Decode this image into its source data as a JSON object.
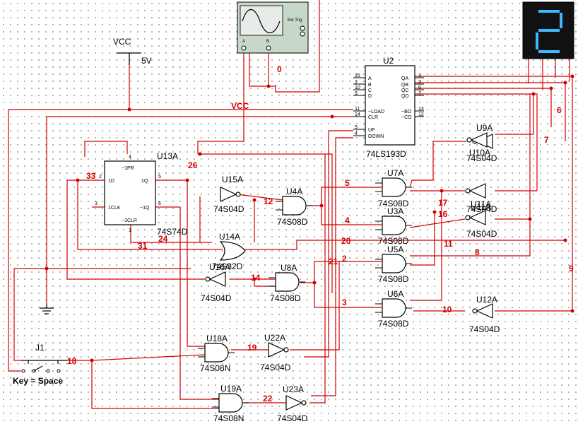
{
  "power": {
    "vcc_top": "VCC",
    "vcc_volts": "5V",
    "vcc_mid": "VCC"
  },
  "scope": {
    "channel_a": "A",
    "channel_b": "B",
    "ext_trig": "Ext Trig"
  },
  "display": {
    "digit": "2",
    "color": "#3db8ff"
  },
  "switch": {
    "ref": "J1",
    "key_label": "Key = Space"
  },
  "counter": {
    "ref": "U2",
    "part": "74LS193D",
    "left_pins": [
      {
        "num": "15",
        "name": "A"
      },
      {
        "num": "1",
        "name": "B"
      },
      {
        "num": "10",
        "name": "C"
      },
      {
        "num": "9",
        "name": "D"
      },
      {
        "num": "11",
        "name": "~LOAD"
      },
      {
        "num": "14",
        "name": "CLR"
      },
      {
        "num": "5",
        "name": "UP"
      },
      {
        "num": "4",
        "name": "DOWN"
      }
    ],
    "right_pins": [
      {
        "num": "3",
        "name": "QA"
      },
      {
        "num": "2",
        "name": "QB"
      },
      {
        "num": "6",
        "name": "QC"
      },
      {
        "num": "7",
        "name": "QD"
      },
      {
        "num": "13",
        "name": "~BO"
      },
      {
        "num": "12",
        "name": "~CO"
      }
    ]
  },
  "flipflop": {
    "ref": "U13A",
    "part": "74S74D",
    "pins": {
      "pr": "~1PR",
      "d": "1D",
      "q": "1Q",
      "clk": "1CLK",
      "qn": "~1Q",
      "clr": "~1CLR",
      "pr_num": "4",
      "d_num": "2",
      "q_num": "5",
      "clk_num": "3",
      "qn_num": "6",
      "clr_num": "1"
    }
  },
  "gates": [
    {
      "ref": "U7A",
      "part": "74S08D"
    },
    {
      "ref": "U3A",
      "part": "74S08D"
    },
    {
      "ref": "U4A",
      "part": "74S08D"
    },
    {
      "ref": "U5A",
      "part": "74S08D"
    },
    {
      "ref": "U8A",
      "part": "74S08D"
    },
    {
      "ref": "U6A",
      "part": "74S08D"
    },
    {
      "ref": "U18A",
      "part": "74S08N"
    },
    {
      "ref": "U19A",
      "part": "74S08N"
    },
    {
      "ref": "U14A",
      "part": "74S32D"
    }
  ],
  "inverters": [
    {
      "ref": "U9A",
      "part": ""
    },
    {
      "ref": "U10A",
      "part": "74S04D"
    },
    {
      "ref": "U11A",
      "part": "74S04D"
    },
    {
      "ref": "U11A",
      "part": "74S04D"
    },
    {
      "ref": "U15A",
      "part": "74S04D"
    },
    {
      "ref": "U16A",
      "part": "74S04D"
    },
    {
      "ref": "U12A",
      "part": "74S04D"
    },
    {
      "ref": "U22A",
      "part": "74S04D"
    },
    {
      "ref": "U23A",
      "part": "74S04D"
    }
  ],
  "nets": [
    "0",
    "6",
    "7",
    "5",
    "4",
    "17",
    "16",
    "12",
    "26",
    "33",
    "24",
    "31",
    "20",
    "11",
    "8",
    "2",
    "21",
    "14",
    "3",
    "10",
    "9",
    "19",
    "18",
    "22"
  ],
  "colors": {
    "wire": "#d40000",
    "body": "#000000",
    "background": "#ffffff",
    "display_bg": "#111111"
  }
}
